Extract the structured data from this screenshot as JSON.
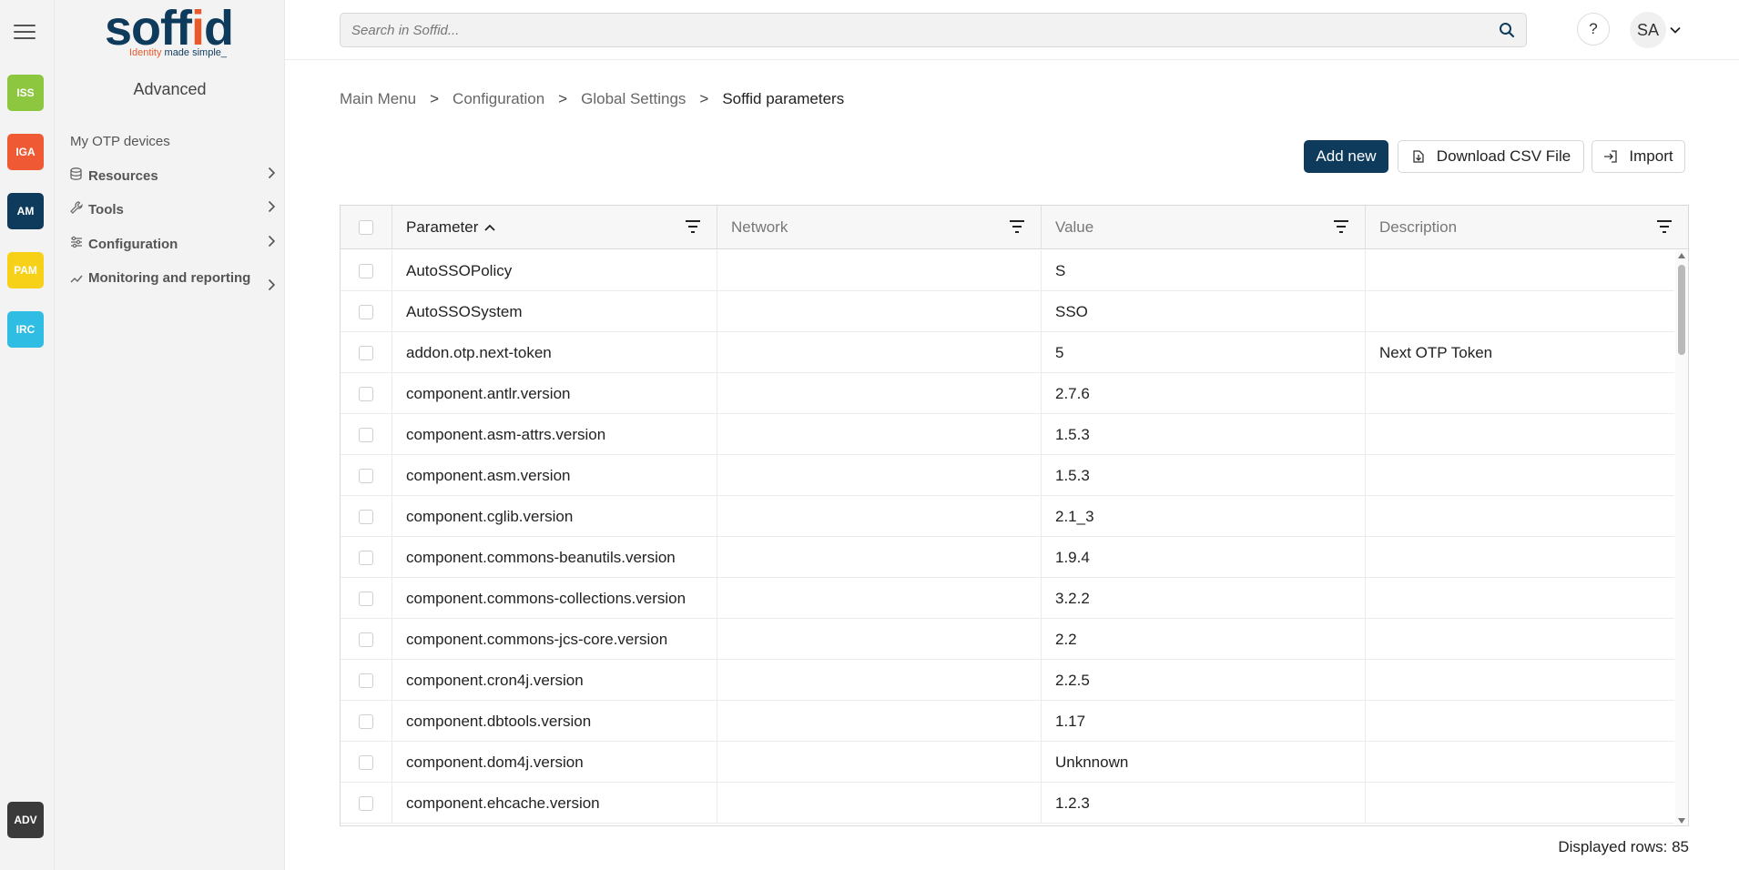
{
  "apps": [
    {
      "label": "ISS",
      "color": "#8dc63f"
    },
    {
      "label": "IGA",
      "color": "#ef5a35"
    },
    {
      "label": "AM",
      "color": "#0e3b5c"
    },
    {
      "label": "PAM",
      "color": "#f7d117"
    },
    {
      "label": "IRC",
      "color": "#2fbde4"
    },
    {
      "label": "ADV",
      "color": "#3a3a3a"
    }
  ],
  "logo": {
    "word_a": "soff",
    "word_b": "i",
    "word_c": "d",
    "tag_a": "Identity",
    "tag_b": "made simple_"
  },
  "sidemenu": {
    "title": "Advanced",
    "items": [
      {
        "label": "My OTP devices"
      },
      {
        "label": "Resources"
      },
      {
        "label": "Tools"
      },
      {
        "label": "Configuration"
      },
      {
        "label": "Monitoring and reporting"
      }
    ]
  },
  "header": {
    "search_placeholder": "Search in Soffid...",
    "help_label": "?",
    "user_initials": "SA"
  },
  "breadcrumb": [
    "Main Menu",
    "Configuration",
    "Global Settings",
    "Soffid parameters"
  ],
  "breadcrumb_sep": ">",
  "actions": {
    "add_label": "Add new",
    "csv_label": "Download CSV File",
    "import_label": "Import"
  },
  "table": {
    "columns": [
      "Parameter",
      "Network",
      "Value",
      "Description"
    ],
    "rows": [
      {
        "parameter": "AutoSSOPolicy",
        "network": "",
        "value": "S",
        "description": ""
      },
      {
        "parameter": "AutoSSOSystem",
        "network": "",
        "value": "SSO",
        "description": ""
      },
      {
        "parameter": "addon.otp.next-token",
        "network": "",
        "value": "5",
        "description": "Next OTP Token"
      },
      {
        "parameter": "component.antlr.version",
        "network": "",
        "value": "2.7.6",
        "description": ""
      },
      {
        "parameter": "component.asm-attrs.version",
        "network": "",
        "value": "1.5.3",
        "description": ""
      },
      {
        "parameter": "component.asm.version",
        "network": "",
        "value": "1.5.3",
        "description": ""
      },
      {
        "parameter": "component.cglib.version",
        "network": "",
        "value": "2.1_3",
        "description": ""
      },
      {
        "parameter": "component.commons-beanutils.version",
        "network": "",
        "value": "1.9.4",
        "description": ""
      },
      {
        "parameter": "component.commons-collections.version",
        "network": "",
        "value": "3.2.2",
        "description": ""
      },
      {
        "parameter": "component.commons-jcs-core.version",
        "network": "",
        "value": "2.2",
        "description": ""
      },
      {
        "parameter": "component.cron4j.version",
        "network": "",
        "value": "2.2.5",
        "description": ""
      },
      {
        "parameter": "component.dbtools.version",
        "network": "",
        "value": "1.17",
        "description": ""
      },
      {
        "parameter": "component.dom4j.version",
        "network": "",
        "value": "Unknnown",
        "description": ""
      },
      {
        "parameter": "component.ehcache.version",
        "network": "",
        "value": "1.2.3",
        "description": ""
      }
    ]
  },
  "footer": {
    "displayed_rows": "Displayed rows: 85"
  }
}
